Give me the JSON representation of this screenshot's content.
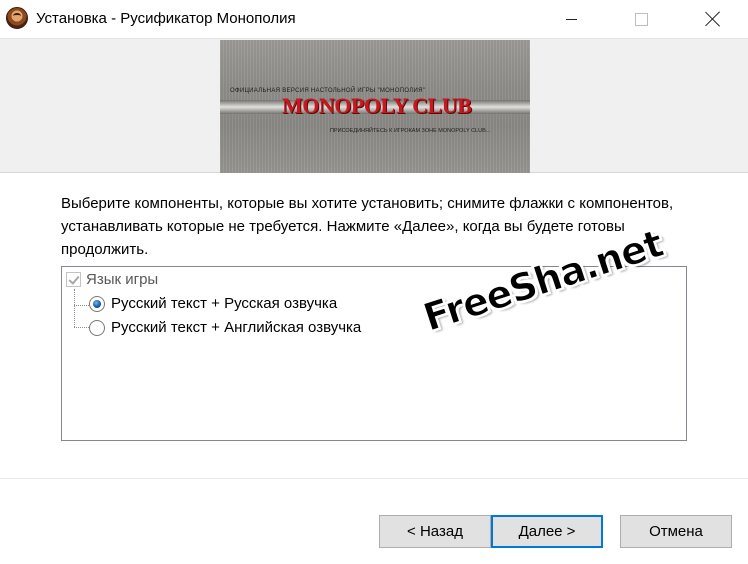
{
  "window": {
    "title": "Установка - Русификатор Монополия"
  },
  "banner": {
    "top_caption": "ОФИЦИАЛЬНАЯ ВЕРСИЯ НАСТОЛЬНОЙ ИГРЫ \"МОНОПОЛИЯ\"",
    "logo_text": "MONOPOLY CLUB",
    "bottom_caption": "ПРИСОЕДИНЯЙТЕСЬ К ИГРОКАМ ЗОНЕ MONOPOLY CLUB..."
  },
  "instruction": {
    "text": "Выберите компоненты, которые вы хотите установить; снимите флажки с компонентов, устанавливать которые не требуется. Нажмите «Далее», когда вы будете готовы продолжить."
  },
  "components": {
    "root": {
      "label": "Язык игры",
      "checked": true,
      "disabled": true
    },
    "options": [
      {
        "label": "Русский текст + Русская озвучка",
        "selected": true
      },
      {
        "label": "Русский текст + Английская озвучка",
        "selected": false
      }
    ]
  },
  "watermark": {
    "text": "FreeSha.net"
  },
  "buttons": {
    "back": "< Назад",
    "next": "Далее >",
    "cancel": "Отмена"
  }
}
